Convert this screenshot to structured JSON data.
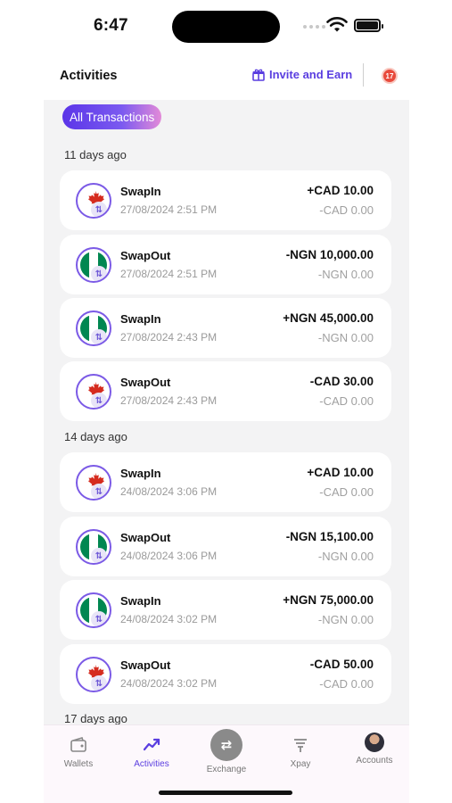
{
  "status": {
    "time": "6:47"
  },
  "header": {
    "title": "Activities",
    "invite_label": "Invite and Earn",
    "notification_count": "17"
  },
  "filter": {
    "label": "All Transactions"
  },
  "groups": [
    {
      "label": "11 days ago"
    },
    {
      "label": "14 days ago"
    },
    {
      "label": "17 days ago"
    }
  ],
  "transactions": [
    {
      "flag": "ca",
      "type": "SwapIn",
      "date": "27/08/2024 2:51 PM",
      "amount": "+CAD 10.00",
      "sub": "-CAD 0.00"
    },
    {
      "flag": "ng",
      "type": "SwapOut",
      "date": "27/08/2024 2:51 PM",
      "amount": "-NGN 10,000.00",
      "sub": "-NGN 0.00"
    },
    {
      "flag": "ng",
      "type": "SwapIn",
      "date": "27/08/2024 2:43 PM",
      "amount": "+NGN 45,000.00",
      "sub": "-NGN 0.00"
    },
    {
      "flag": "ca",
      "type": "SwapOut",
      "date": "27/08/2024 2:43 PM",
      "amount": "-CAD 30.00",
      "sub": "-CAD 0.00"
    },
    {
      "flag": "ca",
      "type": "SwapIn",
      "date": "24/08/2024 3:06 PM",
      "amount": "+CAD 10.00",
      "sub": "-CAD 0.00"
    },
    {
      "flag": "ng",
      "type": "SwapOut",
      "date": "24/08/2024 3:06 PM",
      "amount": "-NGN 15,100.00",
      "sub": "-NGN 0.00"
    },
    {
      "flag": "ng",
      "type": "SwapIn",
      "date": "24/08/2024 3:02 PM",
      "amount": "+NGN 75,000.00",
      "sub": "-NGN 0.00"
    },
    {
      "flag": "ca",
      "type": "SwapOut",
      "date": "24/08/2024 3:02 PM",
      "amount": "-CAD 50.00",
      "sub": "-CAD 0.00"
    }
  ],
  "nav": {
    "items": [
      {
        "label": "Wallets",
        "icon": "wallet-icon"
      },
      {
        "label": "Activities",
        "icon": "activity-icon",
        "active": true
      },
      {
        "label": "Exchange",
        "icon": "exchange-icon"
      },
      {
        "label": "Xpay",
        "icon": "xpay-icon"
      },
      {
        "label": "Accounts",
        "icon": "avatar"
      }
    ]
  },
  "colors": {
    "accent": "#5a3ee0",
    "panel_bg": "#f3f3f4",
    "notif": "#e84a3c"
  }
}
